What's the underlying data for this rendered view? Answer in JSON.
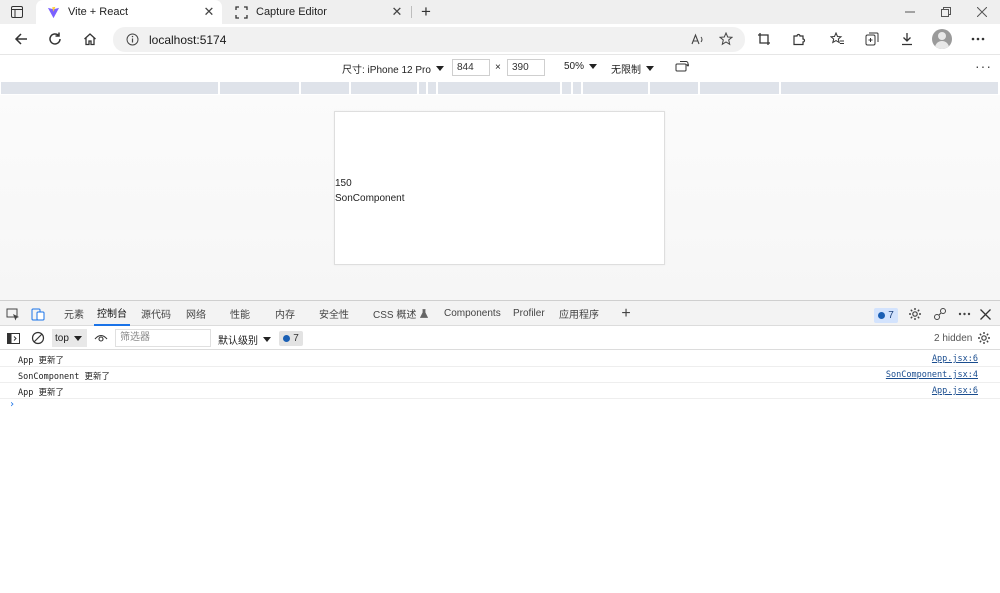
{
  "browser": {
    "tabs": [
      {
        "title": "Vite + React",
        "active": true,
        "favicon": "vite-icon"
      },
      {
        "title": "Capture Editor",
        "active": false,
        "favicon": "capture-icon"
      }
    ],
    "new_tab": "+",
    "address": "localhost:5174"
  },
  "device_toolbar": {
    "device_label": "尺寸: iPhone 12 Pro",
    "width": "844",
    "separator": "×",
    "height": "390",
    "zoom": "50%",
    "throttle": "无限制"
  },
  "page": {
    "count": "150",
    "component_name": "SonComponent"
  },
  "devtools": {
    "tabs": [
      {
        "label": "元素",
        "active": false
      },
      {
        "label": "控制台",
        "active": true
      },
      {
        "label": "源代码",
        "active": false
      },
      {
        "label": "网络",
        "active": false
      },
      {
        "label": "性能",
        "active": false
      },
      {
        "label": "内存",
        "active": false
      },
      {
        "label": "安全性",
        "active": false
      },
      {
        "label": "CSS 概述",
        "active": false
      },
      {
        "label": "Components",
        "active": false
      },
      {
        "label": "Profiler",
        "active": false
      },
      {
        "label": "应用程序",
        "active": false
      }
    ],
    "add_tab": "+",
    "issues_count": "7",
    "console": {
      "context": "top",
      "filter_placeholder": "筛选器",
      "level": "默认级别",
      "issues_count": "7",
      "hidden": "2 hidden",
      "logs": [
        {
          "message": "App 更新了",
          "source": "App.jsx:6"
        },
        {
          "message": "SonComponent 更新了",
          "source": "SonComponent.jsx:4"
        },
        {
          "message": "App 更新了",
          "source": "App.jsx:6"
        }
      ],
      "prompt": "›"
    }
  }
}
